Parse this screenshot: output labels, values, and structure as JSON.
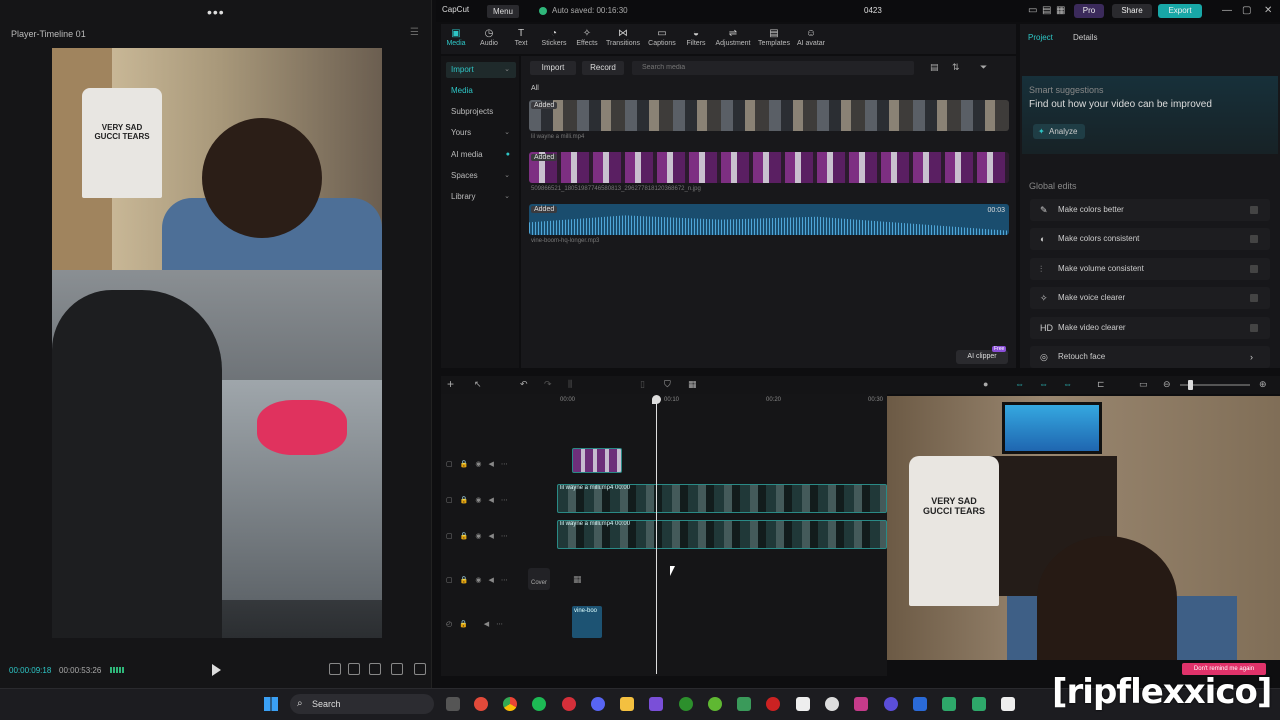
{
  "player": {
    "menu_dots": "•••",
    "title": "Player-Timeline 01",
    "current_time": "00:00:09:18",
    "total_time": "00:00:53:26",
    "shirt_text": "VERY SAD\nGUCCI TEARS"
  },
  "app": {
    "logo": "CapCut",
    "menu_label": "Menu",
    "autosave": "Auto saved: 00:16:30",
    "project_title": "0423",
    "pro_label": "Pro",
    "share_label": "Share",
    "export_label": "Export"
  },
  "toolbar": {
    "items": [
      {
        "label": "Media",
        "icon": "▣"
      },
      {
        "label": "Audio",
        "icon": "◷"
      },
      {
        "label": "Text",
        "icon": "T"
      },
      {
        "label": "Stickers",
        "icon": "◔"
      },
      {
        "label": "Effects",
        "icon": "✧"
      },
      {
        "label": "Transitions",
        "icon": "⋈"
      },
      {
        "label": "Captions",
        "icon": "▭"
      },
      {
        "label": "Filters",
        "icon": "◒"
      },
      {
        "label": "Adjustment",
        "icon": "⇌"
      },
      {
        "label": "Templates",
        "icon": "▤"
      },
      {
        "label": "AI avatar",
        "icon": "☺"
      }
    ]
  },
  "nav": {
    "items": [
      "Import",
      "Media",
      "Subprojects",
      "Yours",
      "AI media",
      "Spaces",
      "Library"
    ]
  },
  "media": {
    "import_label": "Import",
    "record_label": "Record",
    "search_placeholder": "Search media",
    "all_label": "All",
    "clips": [
      {
        "badge": "Added",
        "name": "lil wayne a milli.mp4"
      },
      {
        "badge": "Added",
        "name": "509866521_18051987746580813_296277818120368672_n.jpg"
      },
      {
        "badge": "Added",
        "name": "vine-boom-hq-longer.mp3",
        "duration": "00:03"
      }
    ],
    "ai_clipper": "AI clipper",
    "free_badge": "Free"
  },
  "right_panel": {
    "tab_project": "Project",
    "tab_details": "Details",
    "smart_title": "Smart suggestions",
    "smart_subtitle": "Find out how your video can be improved",
    "analyze_label": "Analyze",
    "global_title": "Global edits",
    "global_items": [
      {
        "label": "Make colors better",
        "icon": "✎"
      },
      {
        "label": "Make colors consistent",
        "icon": "◐"
      },
      {
        "label": "Make volume consistent",
        "icon": "⫶"
      },
      {
        "label": "Make voice clearer",
        "icon": "✧"
      },
      {
        "label": "Make video clearer",
        "icon": "HD"
      },
      {
        "label": "Retouch face",
        "icon": "◎"
      }
    ]
  },
  "timeline": {
    "ruler": [
      "00:00",
      "00:10",
      "00:20",
      "00:30"
    ],
    "video_track_label": "lil wayne a milli.mp4  00:00",
    "audio_clip_label": "vine-boo",
    "cover_label": "Cover",
    "cam_shirt_text": "VERY SAD\nGUCCI TEARS",
    "dont_remind": "Don't remind me again"
  },
  "watermark": "[ripflexxico]",
  "taskbar": {
    "search_label": "Search"
  },
  "colors": {
    "accent": "#2ec6c6",
    "export": "#18a7a7",
    "pro": "#3b2a5b"
  }
}
